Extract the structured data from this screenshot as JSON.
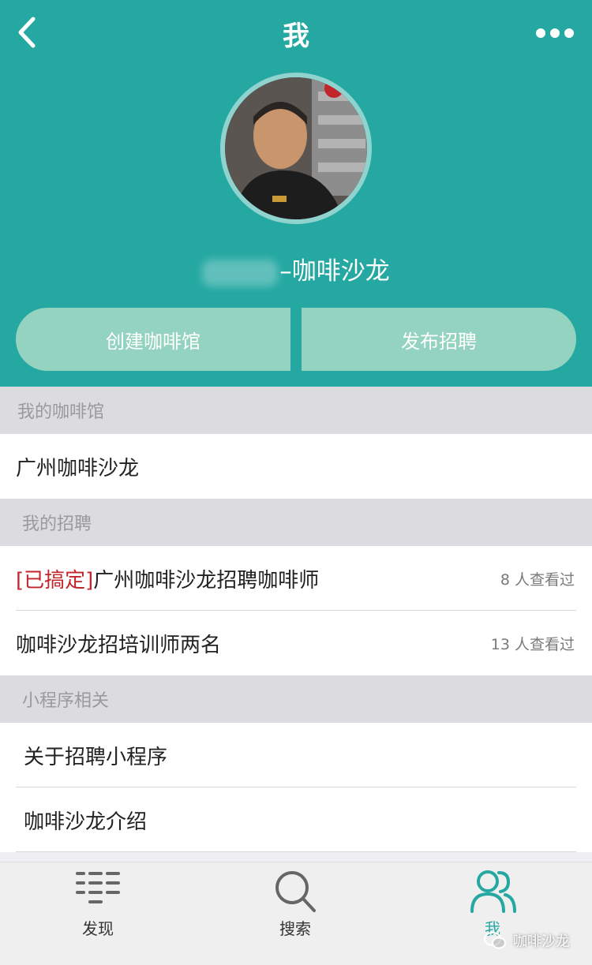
{
  "nav": {
    "title": "我"
  },
  "profile": {
    "name_suffix": "–咖啡沙龙"
  },
  "actions": {
    "create_cafe": "创建咖啡馆",
    "post_job": "发布招聘"
  },
  "sections": {
    "cafes": {
      "title": "我的咖啡馆",
      "items": [
        {
          "label": "广州咖啡沙龙"
        }
      ]
    },
    "jobs": {
      "title": "我的招聘",
      "items": [
        {
          "tag": "[已搞定]",
          "label": "广州咖啡沙龙招聘咖啡师",
          "views": "8 人查看过"
        },
        {
          "tag": "",
          "label": "咖啡沙龙招培训师两名",
          "views": "13 人查看过"
        }
      ]
    },
    "miniprogram": {
      "title": "小程序相关",
      "items": [
        {
          "label": "关于招聘小程序"
        },
        {
          "label": "咖啡沙龙介绍"
        }
      ]
    }
  },
  "tabbar": {
    "tabs": [
      {
        "label": "发现",
        "icon": "list-icon"
      },
      {
        "label": "搜索",
        "icon": "search-icon"
      },
      {
        "label": "我",
        "icon": "people-icon"
      }
    ],
    "active_color": "#25a8a2"
  },
  "watermark": {
    "text": "咖啡沙龙"
  },
  "colors": {
    "header": "#25a8a2",
    "button": "#93d3c0",
    "tag": "#c2262a"
  }
}
